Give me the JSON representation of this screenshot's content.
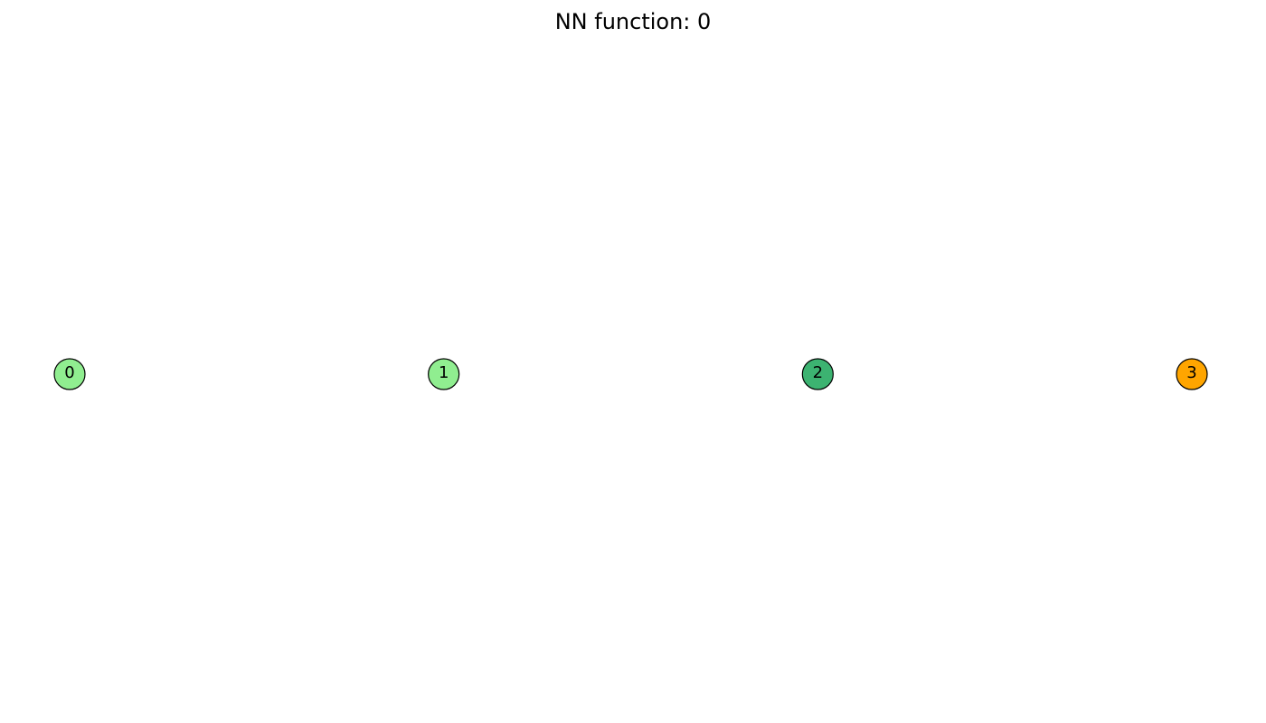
{
  "title": "NN function: 0",
  "nodes": [
    {
      "label": "0",
      "color": "#90ee90"
    },
    {
      "label": "1",
      "color": "#90ee90"
    },
    {
      "label": "2",
      "color": "#3cb371"
    },
    {
      "label": "3",
      "color": "#ffa500"
    }
  ],
  "edges": []
}
